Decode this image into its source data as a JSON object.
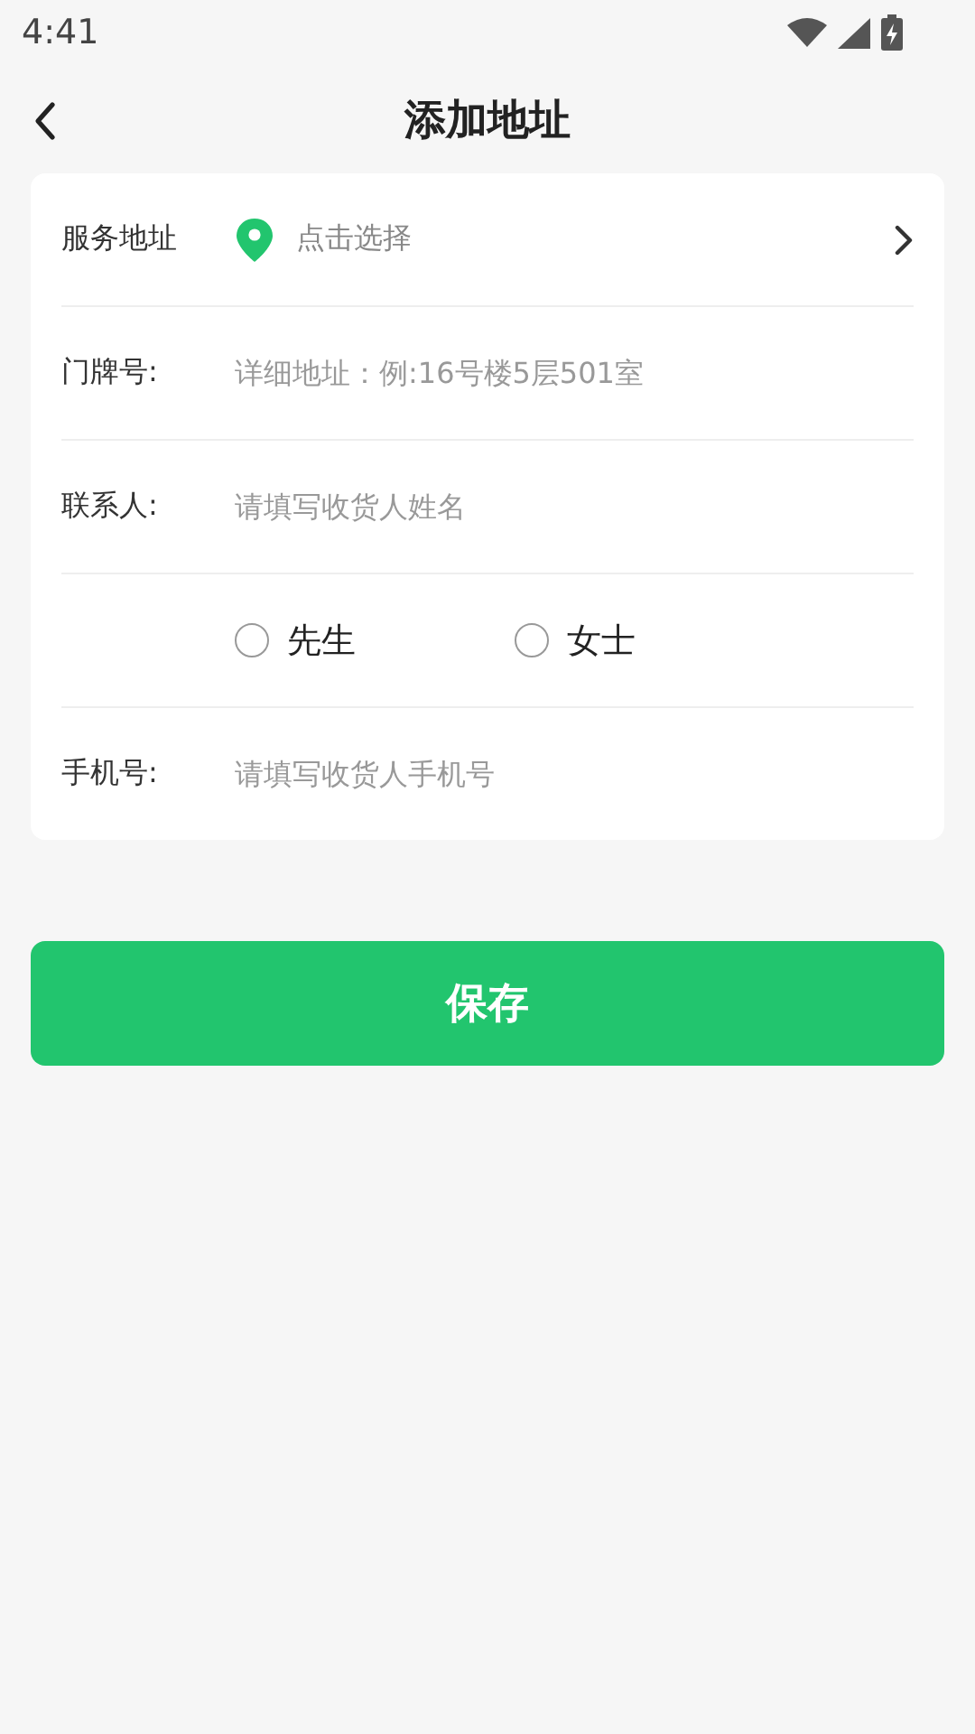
{
  "status_bar": {
    "time": "4:41"
  },
  "header": {
    "title": "添加地址"
  },
  "form": {
    "rows": [
      {
        "kind": "picker",
        "label": "服务地址",
        "placeholder": "点击选择"
      },
      {
        "kind": "input",
        "label": "门牌号:",
        "placeholder": "详细地址：例:16号楼5层501室"
      },
      {
        "kind": "input",
        "label": "联系人:",
        "placeholder": "请填写收货人姓名"
      },
      {
        "kind": "radio",
        "options": [
          {
            "label": "先生",
            "selected": false
          },
          {
            "label": "女士",
            "selected": false
          }
        ]
      },
      {
        "kind": "input",
        "label": "手机号:",
        "placeholder": "请填写收货人手机号"
      }
    ]
  },
  "save_button": {
    "label": "保存"
  }
}
